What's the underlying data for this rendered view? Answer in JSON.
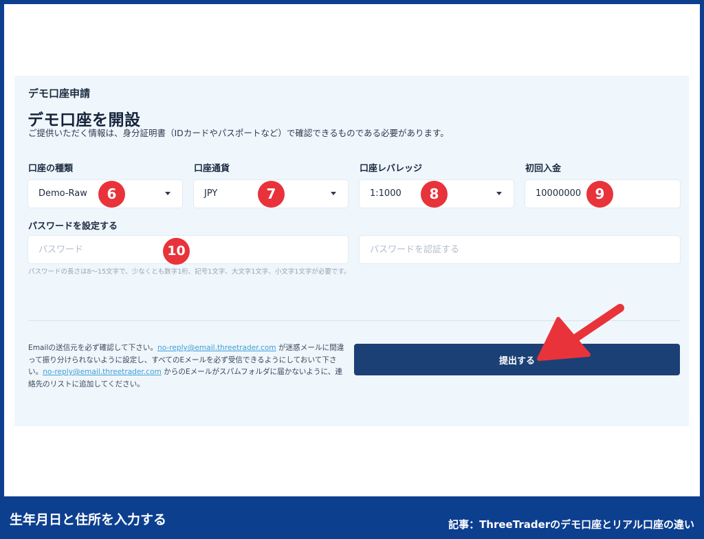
{
  "header": {
    "breadcrumb": "デモ口座申請",
    "title": "デモ口座を開設",
    "description": "ご提供いただく情報は、身分証明書（IDカードやパスポートなど）で確認できるものである必要があります。"
  },
  "fields": {
    "account_type": {
      "label": "口座の種類",
      "value": "Demo-Raw",
      "badge": "6"
    },
    "currency": {
      "label": "口座通貨",
      "value": "JPY",
      "badge": "7"
    },
    "leverage": {
      "label": "口座レバレッジ",
      "value": "1:1000",
      "badge": "8"
    },
    "deposit": {
      "label": "初回入金",
      "value": "10000000",
      "badge": "9"
    },
    "password": {
      "label": "パスワードを設定する",
      "placeholder": "パスワード",
      "confirm_placeholder": "パスワードを認証する",
      "badge": "10",
      "hint": "パスワードの長さは8～15文字で、少なくとも数字1桁、記号1文字、大文字1文字、小文字1文字が必要です。"
    }
  },
  "notice": {
    "part1": "Emailの送信元を必ず確認して下さい。",
    "email1": "no-reply@email.threetrader.com",
    "part2": " が迷惑メールに間違って振り分けられないように設定し、すべてのEメールを必ず受信できるようにしておいて下さい。",
    "email2": "no-reply@email.threetrader.com",
    "part3": " からのEメールがスパムフォルダに届かないように、連絡先のリストに追加してください。"
  },
  "submit_label": "提出する",
  "footer": {
    "caption": "生年月日と住所を入力する",
    "article": "記事：ThreeTraderのデモ口座とリアル口座の違い"
  },
  "colors": {
    "frame": "#0d3f8f",
    "panel": "#eff6fc",
    "submit": "#1b4075",
    "badge": "#e8333a",
    "link": "#3f9fd8"
  }
}
